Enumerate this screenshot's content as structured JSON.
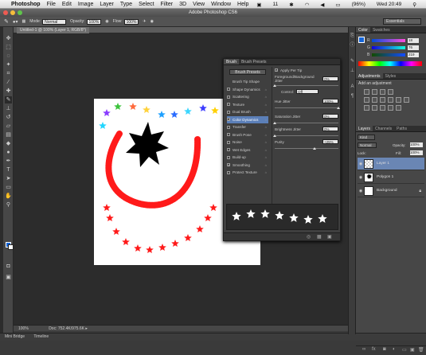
{
  "menubar": {
    "app": "Photoshop",
    "items": [
      "File",
      "Edit",
      "Image",
      "Layer",
      "Type",
      "Select",
      "Filter",
      "3D",
      "View",
      "Window",
      "Help"
    ],
    "status": {
      "battery_text": "(96%)",
      "clock": "Wed 20:49",
      "notif_count": "11"
    }
  },
  "window": {
    "title": "Adobe Photoshop CS6"
  },
  "options": {
    "mode_label": "Mode:",
    "mode_value": "Normal",
    "opacity_label": "Opacity:",
    "opacity_value": "100%",
    "flow_label": "Flow:",
    "flow_value": "100%",
    "workspace": "Essentials"
  },
  "document": {
    "tab": "Untitled-1 @ 100% (Layer 1, RGB/8*)",
    "zoom": "100%",
    "doc_info": "Doc: 752.4K/975.6K"
  },
  "brush_panel": {
    "tabs": [
      "Brush",
      "Brush Presets"
    ],
    "presets_button": "Brush Presets",
    "items": [
      {
        "label": "Brush Tip Shape",
        "checkbox": false,
        "checked": false,
        "locked": false,
        "selected": false
      },
      {
        "label": "Shape Dynamics",
        "checkbox": true,
        "checked": false,
        "locked": true,
        "selected": false
      },
      {
        "label": "Scattering",
        "checkbox": true,
        "checked": false,
        "locked": true,
        "selected": false
      },
      {
        "label": "Texture",
        "checkbox": true,
        "checked": false,
        "locked": true,
        "selected": false
      },
      {
        "label": "Dual Brush",
        "checkbox": true,
        "checked": false,
        "locked": true,
        "selected": false
      },
      {
        "label": "Color Dynamics",
        "checkbox": true,
        "checked": true,
        "locked": true,
        "selected": true
      },
      {
        "label": "Transfer",
        "checkbox": true,
        "checked": false,
        "locked": true,
        "selected": false
      },
      {
        "label": "Brush Pose",
        "checkbox": true,
        "checked": false,
        "locked": true,
        "selected": false
      },
      {
        "label": "Noise",
        "checkbox": true,
        "checked": false,
        "locked": true,
        "selected": false
      },
      {
        "label": "Wet Edges",
        "checkbox": true,
        "checked": false,
        "locked": true,
        "selected": false
      },
      {
        "label": "Build-up",
        "checkbox": true,
        "checked": false,
        "locked": true,
        "selected": false
      },
      {
        "label": "Smoothing",
        "checkbox": true,
        "checked": true,
        "locked": true,
        "selected": false
      },
      {
        "label": "Protect Texture",
        "checkbox": true,
        "checked": false,
        "locked": true,
        "selected": false
      }
    ],
    "apply_per_tip": "Apply Per Tip",
    "fg_bg_jitter_label": "Foreground/Background Jitter",
    "fg_bg_jitter": "0%",
    "control_label": "Control:",
    "control_value": "Off",
    "hue_jitter_label": "Hue Jitter",
    "hue_jitter": "100%",
    "saturation_jitter_label": "Saturation Jitter",
    "saturation_jitter": "0%",
    "brightness_jitter_label": "Brightness Jitter",
    "brightness_jitter": "0%",
    "purity_label": "Purity",
    "purity": "+25%",
    "slider_levels": {
      "fg_bg_jitter": 0,
      "hue_jitter": 1.0,
      "saturation_jitter": 0,
      "brightness_jitter": 0,
      "purity": 0.625
    }
  },
  "color_panel": {
    "tabs": [
      "Color",
      "Swatches"
    ],
    "r_label": "R",
    "g_label": "G",
    "b_label": "B",
    "r": "18",
    "g": "76",
    "b": "219"
  },
  "adjustments_panel": {
    "tabs": [
      "Adjustments",
      "Styles"
    ],
    "heading": "Add an adjustment"
  },
  "layers_panel": {
    "tabs": [
      "Layers",
      "Channels",
      "Paths"
    ],
    "kind_label": "Kind",
    "blend_mode": "Normal",
    "opacity_label": "Opacity:",
    "opacity": "100%",
    "lock_label": "Lock:",
    "fill_label": "Fill:",
    "fill": "100%",
    "layers": [
      {
        "name": "Layer 1",
        "selected": true,
        "visible": true,
        "thumb": "checker"
      },
      {
        "name": "Polygon 1",
        "selected": false,
        "visible": true,
        "thumb": "star"
      },
      {
        "name": "Background",
        "selected": false,
        "visible": true,
        "thumb": "white"
      }
    ]
  },
  "bottom_tabs": [
    "Mini Bridge",
    "Timeline"
  ],
  "colors": {
    "foreground": "#1565d8",
    "background": "#ffffff",
    "selection": "#6a86b4"
  }
}
